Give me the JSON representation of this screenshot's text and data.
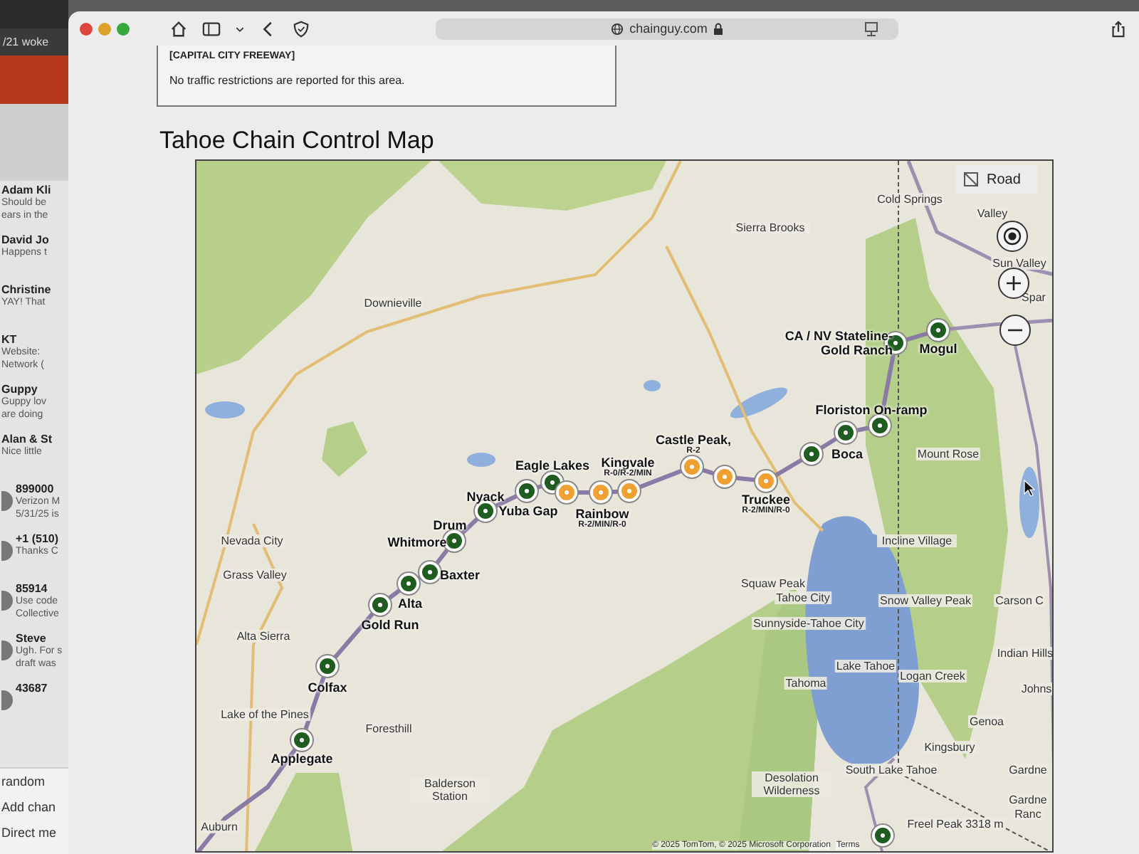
{
  "sidebar": {
    "header": "/21 woke",
    "chats": [
      {
        "name": "Adam Kli",
        "preview": [
          "Should be",
          "ears in the"
        ],
        "avatar": false
      },
      {
        "name": "David Jo",
        "preview": [
          "Happens t"
        ],
        "avatar": false
      },
      {
        "name": "Christine",
        "preview": [
          "YAY! That"
        ],
        "avatar": false
      },
      {
        "name": "KT",
        "preview": [
          "Website:",
          "Network ("
        ],
        "avatar": false
      },
      {
        "name": "Guppy",
        "preview": [
          "Guppy lov",
          "are doing"
        ],
        "avatar": false
      },
      {
        "name": "Alan & St",
        "preview": [
          "Nice little"
        ],
        "avatar": false
      },
      {
        "name": "899000",
        "preview": [
          "Verizon M",
          "5/31/25 is"
        ],
        "avatar": true
      },
      {
        "name": "+1 (510)",
        "preview": [
          "Thanks C"
        ],
        "avatar": true
      },
      {
        "name": "85914",
        "preview": [
          "Use code",
          "Collective"
        ],
        "avatar": true
      },
      {
        "name": "Steve",
        "preview": [
          "Ugh. For s",
          "draft was"
        ],
        "avatar": true
      },
      {
        "name": "43687",
        "avatar": true
      }
    ],
    "sections": [
      "random",
      "Add chan",
      "Direct me"
    ]
  },
  "browser": {
    "url": "chainguy.com"
  },
  "notice": {
    "title": "[CAPITAL CITY FREEWAY]",
    "text": "No traffic restrictions are reported for this area."
  },
  "heading": "Tahoe Chain Control Map",
  "map": {
    "layer_button": "Road",
    "places": [
      "Cold Springs",
      "Valley",
      "Sierra Brooks",
      "Sun Valley",
      "Spar",
      "Downieville",
      "Nevada City",
      "Grass Valley",
      "Alta Sierra",
      "Lake of the Pines",
      "Auburn",
      "Foresthill",
      "Balderson Station",
      "Mount Rose",
      "Incline Village",
      "Squaw Peak",
      "Tahoe City",
      "Sunnyside-Tahoe City",
      "Snow Valley Peak",
      "Lake Tahoe",
      "Tahoma",
      "Logan Creek",
      "Carson C",
      "Indian Hills",
      "Johns",
      "Genoa",
      "Kingsbury",
      "Desolation Wilderness",
      "South Lake Tahoe",
      "Gardne",
      "Gardne",
      "Ranc",
      "Freel Peak 3318 m"
    ],
    "stations": [
      {
        "name": "CA / NV Stateline-Gold Ranch"
      },
      {
        "name": "Mogul"
      },
      {
        "name": "Floriston On-ramp"
      },
      {
        "name": "Castle Peak,",
        "restriction": "R-2"
      },
      {
        "name": "Boca"
      },
      {
        "name": "Eagle Lakes"
      },
      {
        "name": "Kingvale",
        "restriction": "R-0/R-2/MIN"
      },
      {
        "name": "Nyack"
      },
      {
        "name": "Drum"
      },
      {
        "name": "Yuba Gap"
      },
      {
        "name": "Rainbow",
        "restriction": "R-2/MIN/R-0"
      },
      {
        "name": "Truckee",
        "restriction": "R-2/MIN/R-0"
      },
      {
        "name": "Whitmore"
      },
      {
        "name": "Baxter"
      },
      {
        "name": "Alta"
      },
      {
        "name": "Gold Run"
      },
      {
        "name": "Colfax"
      },
      {
        "name": "Applegate"
      }
    ],
    "pins": [
      {
        "color": "#1f5c1f"
      },
      {
        "color": "#1f5c1f"
      },
      {
        "color": "#1f5c1f"
      },
      {
        "color": "#1f5c1f"
      },
      {
        "color": "#1f5c1f"
      },
      {
        "color": "#1f5c1f"
      },
      {
        "color": "#1f5c1f"
      },
      {
        "color": "#1f5c1f"
      },
      {
        "color": "#1f5c1f"
      },
      {
        "color": "#f0a030"
      },
      {
        "color": "#f0a030"
      },
      {
        "color": "#f0a030"
      },
      {
        "color": "#f0a030"
      },
      {
        "color": "#f0a030"
      },
      {
        "color": "#f0a030"
      },
      {
        "color": "#1f5c1f"
      },
      {
        "color": "#1f5c1f"
      },
      {
        "color": "#1f5c1f"
      },
      {
        "color": "#1f5c1f"
      },
      {
        "color": "#1f5c1f"
      },
      {
        "color": "#1f5c1f"
      }
    ],
    "attribution": "© 2025 TomTom, © 2025 Microsoft Corporation",
    "terms": "Terms"
  }
}
